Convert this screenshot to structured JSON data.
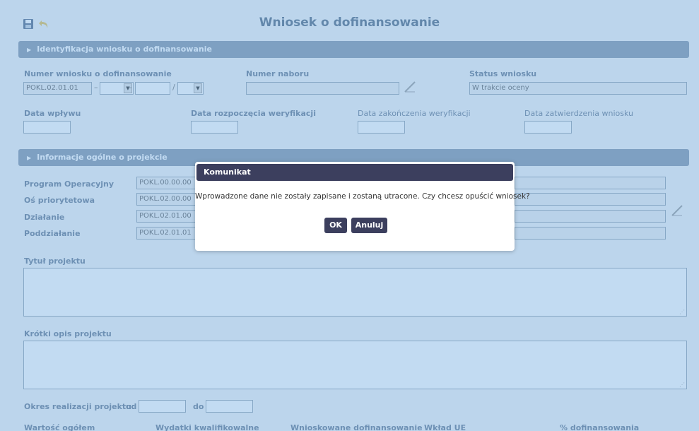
{
  "header": {
    "title": "Wniosek o dofinansowanie",
    "save_icon": "save-icon",
    "undo_icon": "undo-icon"
  },
  "sections": {
    "identification": "Identyfikacja wniosku o dofinansowanie",
    "general_info": "Informacje ogólne o projekcie"
  },
  "identification": {
    "application_number_label": "Numer wniosku o dofinansowanie",
    "application_number_prefix": "POKL.02.01.01",
    "separator_dash": "–",
    "separator_slash": "/",
    "recruitment_number_label": "Numer naboru",
    "recruitment_number_value": "",
    "status_label": "Status wniosku",
    "status_value": "W trakcie oceny",
    "receipt_date_label": "Data wpływu",
    "verification_start_label": "Data rozpoczęcia weryfikacji",
    "verification_end_label": "Data zakończenia weryfikacji",
    "approval_date_label": "Data zatwierdzenia wniosku"
  },
  "general": {
    "program_label": "Program Operacyjny",
    "program_value": "POKL.00.00.00",
    "axis_label": "Oś priorytetowa",
    "axis_value": "POKL.02.00.00",
    "action_label": "Działanie",
    "action_value": "POKL.02.01.00",
    "subaction_label": "Poddziałanie",
    "subaction_value": "POKL.02.01.01",
    "project_title_label": "Tytuł projektu",
    "short_description_label": "Krótki opis projektu",
    "period_label": "Okres realizacji projektu:",
    "period_from_label": "od",
    "period_to_label": "do",
    "total_value_label": "Wartość ogółem",
    "eligible_expenses_label": "Wydatki kwalifikowalne",
    "requested_funding_label": "Wnioskowane dofinansowanie",
    "eu_contribution_label": "Wkład UE",
    "funding_percent_label": "% dofinansowania"
  },
  "dialog": {
    "title": "Komunikat",
    "message": "Wprowadzone dane nie zostały zapisane i zostaną utracone. Czy chcesz opuścić wniosek?",
    "ok_label": "OK",
    "cancel_label": "Anuluj"
  },
  "colors": {
    "overlay": "#6eaae1",
    "section_bar": "#8a99ad",
    "dialog_header": "#3c3f5e",
    "dialog_button": "#3c3f5e"
  }
}
